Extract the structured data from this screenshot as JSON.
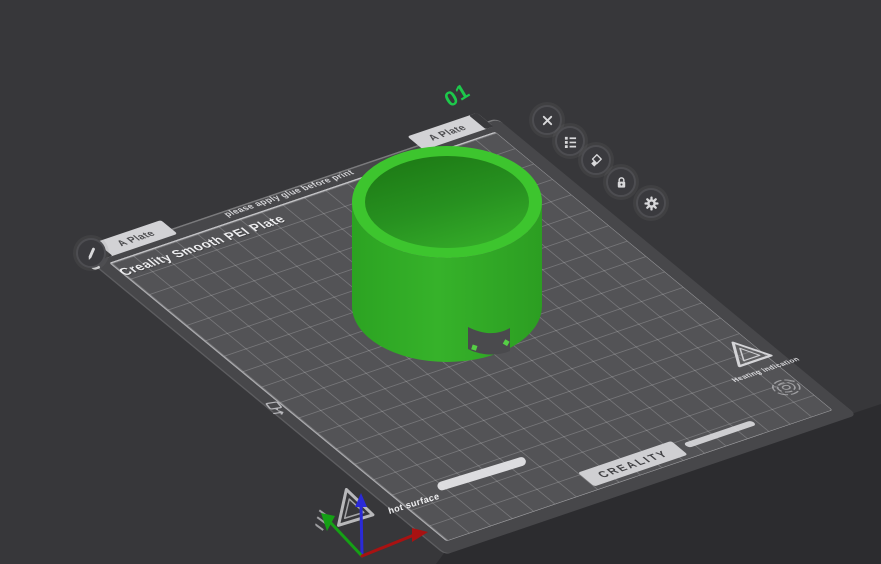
{
  "window": {
    "background": "#37373a"
  },
  "plate": {
    "number": "01",
    "number_color": "#1dc94b",
    "name_tab_left": "A Plate",
    "name_tab_top": "A Plate",
    "surface_label": "Creality Smooth PEI Plate",
    "glue_notice": "please apply glue before print",
    "brand_label": "CREALITY",
    "heating_label": "Heating indication",
    "hot_surface_label": "hot surface"
  },
  "plate_toolbar": {
    "buttons": [
      {
        "name": "close-plate",
        "icon": "close-icon"
      },
      {
        "name": "plate-list",
        "icon": "list-icon"
      },
      {
        "name": "duplicate-plate",
        "icon": "duplicate-icon"
      },
      {
        "name": "lock-plate",
        "icon": "lock-icon"
      },
      {
        "name": "plate-settings",
        "icon": "gear-icon"
      }
    ],
    "edit_button": {
      "name": "rename-plate",
      "icon": "pencil-icon"
    }
  },
  "model": {
    "name": "cylinder",
    "color": "#2fa325",
    "rim_color": "#3dc52e"
  },
  "axes": {
    "x_color": "#a81212",
    "y_color": "#15a015",
    "z_color": "#2a2ad8"
  }
}
